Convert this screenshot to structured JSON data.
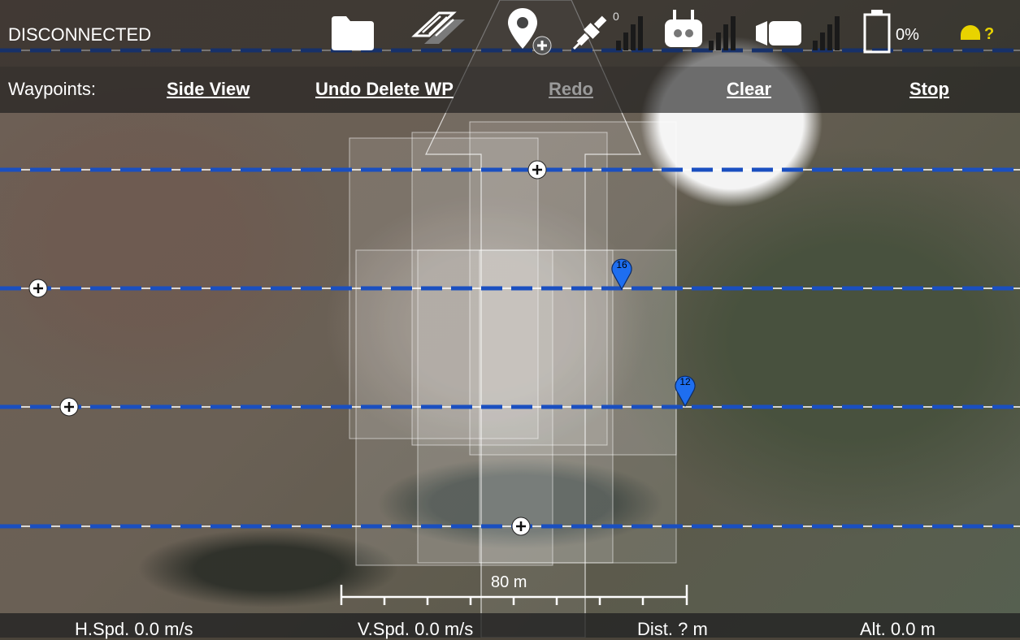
{
  "status": {
    "connection": "DISCONNECTED"
  },
  "toolbar": {
    "icons": [
      "folder-icon",
      "mission-layers-icon",
      "add-waypoint-icon",
      "satellite-icon",
      "remote-controller-icon",
      "camera-icon",
      "battery-icon",
      "sun-indicator-icon"
    ],
    "gps_count": "0",
    "battery_percent": "0%",
    "sun_status": "?"
  },
  "waypoints_bar": {
    "label": "Waypoints:",
    "side_view": "Side View",
    "undo": "Undo Delete WP",
    "redo": "Redo",
    "clear": "Clear",
    "stop": "Stop"
  },
  "map": {
    "markers": [
      {
        "label": "16"
      },
      {
        "label": "12"
      }
    ],
    "scale_label": "80 m"
  },
  "telemetry": {
    "hspd": "H.Spd. 0.0 m/s",
    "vspd": "V.Spd. 0.0 m/s",
    "dist": "Dist. ? m",
    "alt": "Alt. 0.0 m"
  },
  "colors": {
    "route": "#1a4fc0",
    "marker": "#1e6ef0",
    "accent": "#e8d300"
  }
}
